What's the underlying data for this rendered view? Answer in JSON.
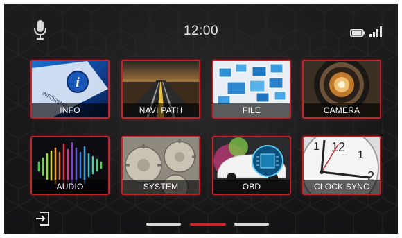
{
  "status_bar": {
    "time": "12:00",
    "icons": [
      "microphone-icon",
      "battery-icon",
      "signal-icon"
    ]
  },
  "apps": [
    {
      "label": "INFO",
      "art_text": "INFORMATION"
    },
    {
      "label": "NAVI PATH"
    },
    {
      "label": "FILE"
    },
    {
      "label": "CAMERA"
    },
    {
      "label": "AUDIO"
    },
    {
      "label": "SYSTEM"
    },
    {
      "label": "OBD"
    },
    {
      "label": "CLOCK SYNC"
    }
  ],
  "pager": {
    "pages": 3,
    "active_page": 2,
    "active_color": "#c9252d",
    "inactive_color": "#d8d8d8"
  },
  "theme": {
    "tile_border": "#c2242b",
    "background": "#1a1a1c"
  },
  "footer": {
    "exit_icon": "exit-icon"
  }
}
